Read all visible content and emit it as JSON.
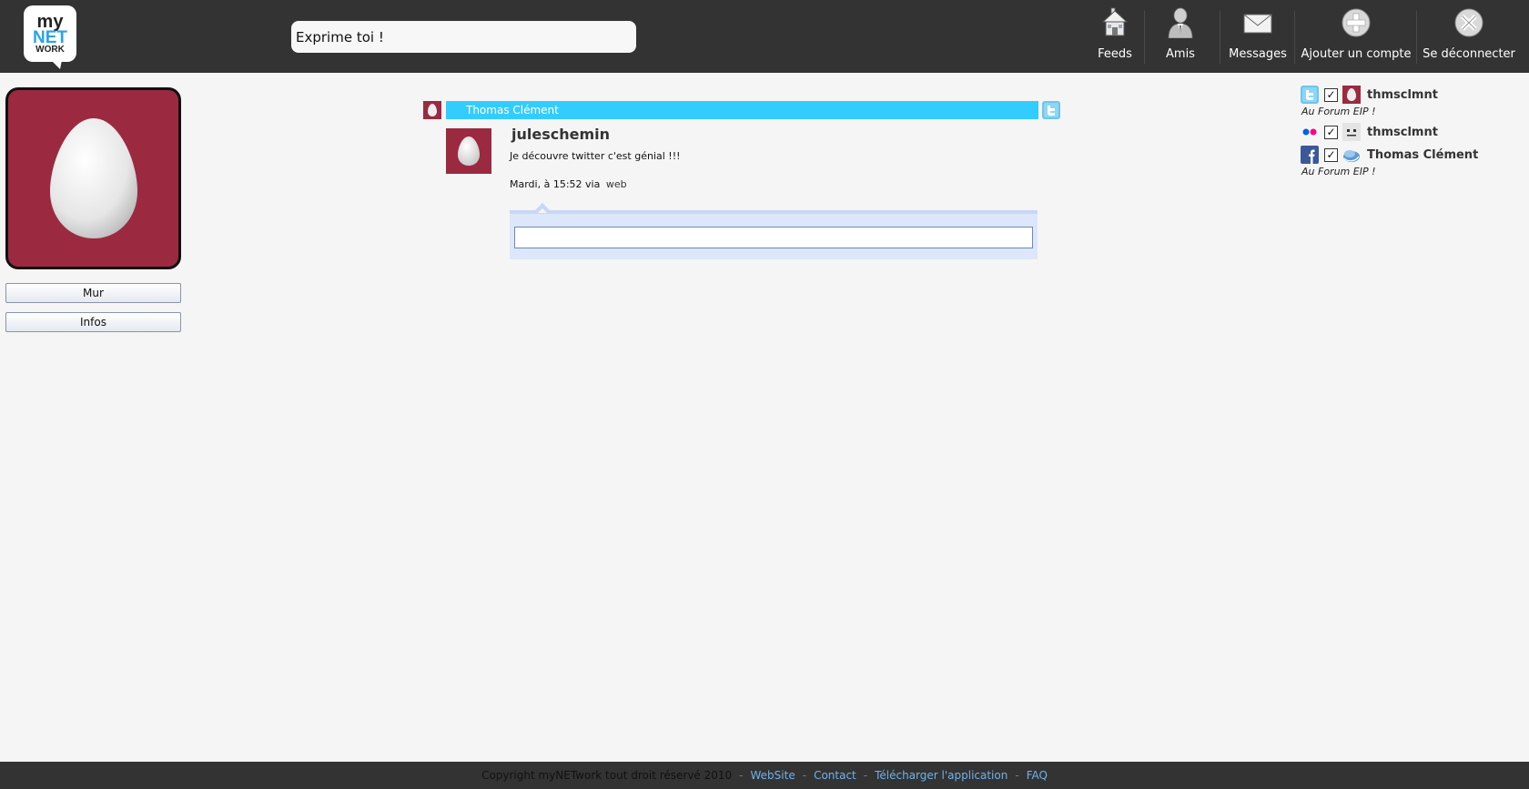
{
  "header": {
    "logo": {
      "line1": "my",
      "line2": "NET",
      "line3": "WORK"
    },
    "status_placeholder": "Exprime toi !",
    "nav": [
      {
        "label": "Feeds",
        "icon": "house-icon"
      },
      {
        "label": "Amis",
        "icon": "person-icon"
      },
      {
        "label": "Messages",
        "icon": "envelope-icon"
      },
      {
        "label": "Ajouter un compte",
        "icon": "plus-circle-icon"
      },
      {
        "label": "Se déconnecter",
        "icon": "close-circle-icon"
      }
    ]
  },
  "sidebar": {
    "buttons": [
      {
        "label": "Mur"
      },
      {
        "label": "Infos"
      }
    ]
  },
  "feed": {
    "post": {
      "owner": "Thomas Clément",
      "service": "twitter",
      "author": "juleschemin",
      "text": "Je découvre twitter c'est génial !!!",
      "time": "Mardi, à 15:52",
      "via_label": "via",
      "via_source": "web",
      "reply_value": ""
    }
  },
  "accounts": [
    {
      "service": "twitter",
      "checked": true,
      "name": "thmsclmnt",
      "status": "Au Forum EIP !"
    },
    {
      "service": "flickr",
      "checked": true,
      "name": "thmsclmnt",
      "status": ""
    },
    {
      "service": "facebook",
      "checked": true,
      "name": "Thomas Clément",
      "status": "Au Forum EIP !"
    }
  ],
  "footer": {
    "copyright": "Copyright myNETwork tout droit réservé 2010",
    "separator": "-",
    "links": [
      {
        "label": "WebSite"
      },
      {
        "label": "Contact"
      },
      {
        "label": "Télécharger l'application"
      },
      {
        "label": "FAQ"
      }
    ]
  },
  "colors": {
    "topbar": "#333333",
    "background": "#f5f5f5",
    "accent": "#33ccff",
    "avatar": "#9b2a40",
    "link": "#6fb1ea"
  }
}
